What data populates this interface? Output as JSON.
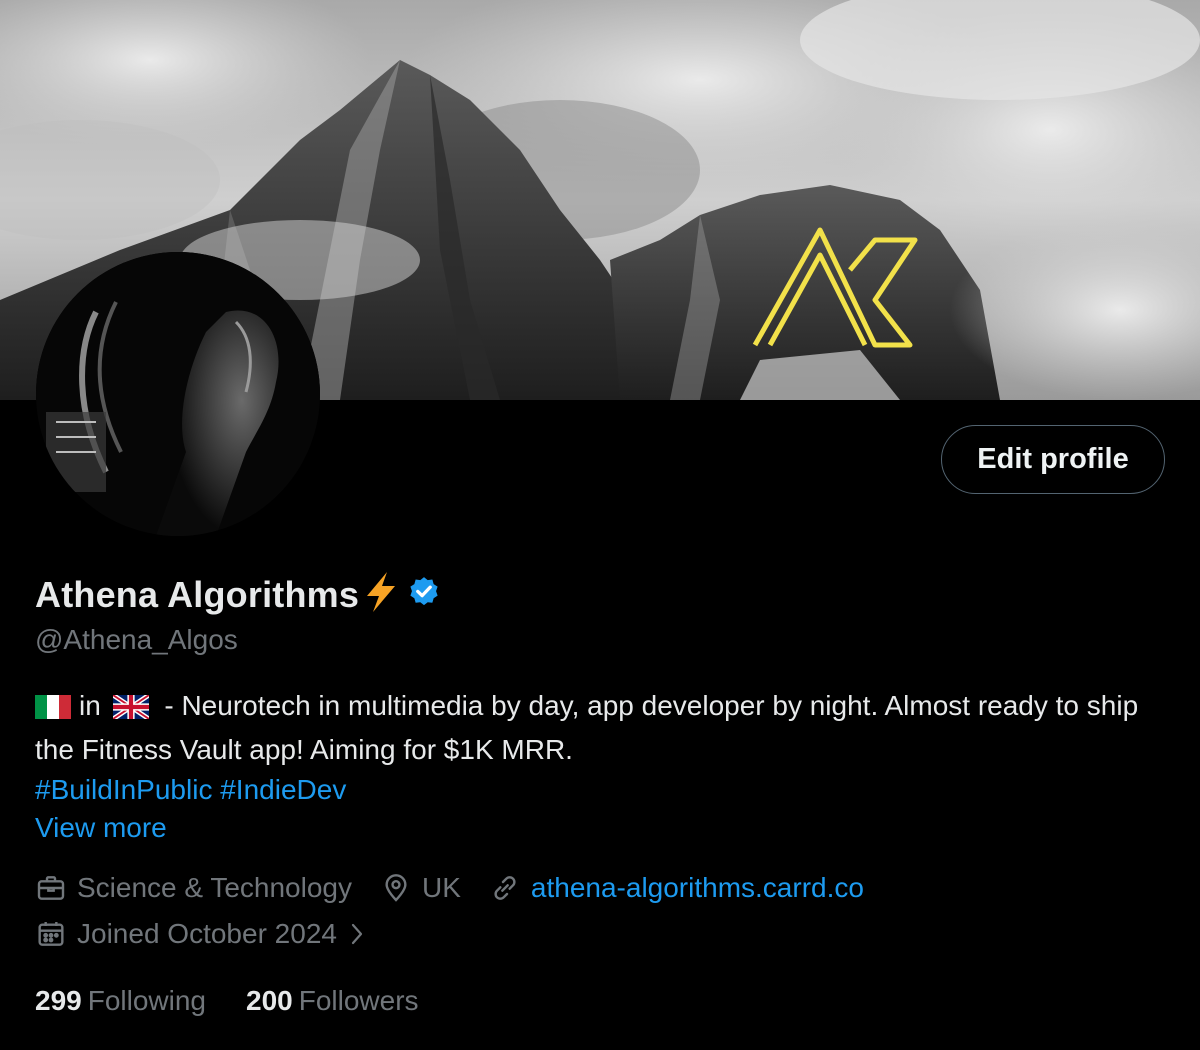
{
  "profile": {
    "display_name": "Athena Algorithms",
    "handle": "@Athena_Algos",
    "edit_label": "Edit profile",
    "bio": {
      "origin_flag": "italy-flag",
      "in_word": "in",
      "current_flag": "uk-flag",
      "text": " - Neurotech in multimedia by day, app developer by night. Almost ready to ship the Fitness Vault app! Aiming for $1K MRR.",
      "hashtags": [
        "#BuildInPublic",
        "#IndieDev"
      ]
    },
    "view_more": "View more",
    "category": "Science & Technology",
    "location": "UK",
    "website": "athena-algorithms.carrd.co",
    "joined": "Joined October 2024",
    "following_count": "299",
    "following_label": "Following",
    "followers_count": "200",
    "followers_label": "Followers"
  },
  "icons": {
    "name_emoji": "lightning-bolt-icon",
    "verified": "verified-badge-icon",
    "category": "briefcase-icon",
    "location": "location-pin-icon",
    "website": "link-icon",
    "joined": "calendar-icon",
    "joined_more": "chevron-right-icon"
  },
  "colors": {
    "background": "#000000",
    "accent": "#1d9bf0",
    "secondary_text": "#71767b",
    "logo_yellow": "#f2e14a",
    "bolt_orange": "#f7a325"
  }
}
